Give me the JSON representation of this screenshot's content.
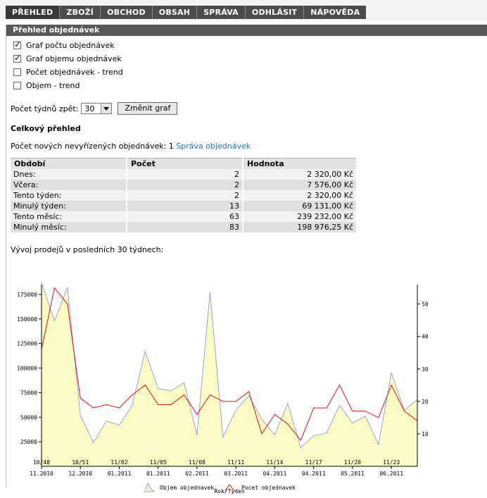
{
  "nav": [
    "PŘEHLED",
    "ZBOŽÍ",
    "OBCHOD",
    "OBSAH",
    "SPRÁVA",
    "ODHLÁSIT",
    "NÁPOVĚDA"
  ],
  "panel_title": "Přehled objednávek",
  "options": [
    {
      "label": "Graf počtu objednávek",
      "checked": true
    },
    {
      "label": "Graf objemu objednávek",
      "checked": true
    },
    {
      "label": "Počet objednávek - trend",
      "checked": false
    },
    {
      "label": "Objem - trend",
      "checked": false
    }
  ],
  "weeks": {
    "label": "Počet týdnů zpět:",
    "value": "30",
    "button": "Změnit graf"
  },
  "overview_title": "Celkový přehled",
  "pending": {
    "text": "Počet nových nevyřízených objednávek: 1",
    "link": "Správa objednávek"
  },
  "table": {
    "headers": [
      "Období",
      "Počet",
      "Hodnota"
    ],
    "rows": [
      [
        "Dnes:",
        "2",
        "2 320,00 Kč"
      ],
      [
        "Včera:",
        "2",
        "7 576,00 Kč"
      ],
      [
        "Tento týden:",
        "2",
        "2 320,00 Kč"
      ],
      [
        "Minulý týden:",
        "13",
        "69 131,00 Kč"
      ],
      [
        "Tento měsíc:",
        "63",
        "239 232,00 Kč"
      ],
      [
        "Minulý měsíc:",
        "83",
        "198 976,25 Kč"
      ]
    ]
  },
  "chart_title": "Vývoj prodejů v posledních 30 týdnech:",
  "chart_data": {
    "type": "line",
    "xlabel": "Rok/Tyden",
    "x_ticks": [
      {
        "week": "10/48",
        "month": "11.2010"
      },
      {
        "week": "10/51",
        "month": "12.2010"
      },
      {
        "week": "11/02",
        "month": "01.2011"
      },
      {
        "week": "11/05",
        "month": "01.2011"
      },
      {
        "week": "11/08",
        "month": "02.2011"
      },
      {
        "week": "11/11",
        "month": "03.2011"
      },
      {
        "week": "11/14",
        "month": "04.2011"
      },
      {
        "week": "11/17",
        "month": "04.2011"
      },
      {
        "week": "11/20",
        "month": "05.2011"
      },
      {
        "week": "11/23",
        "month": "06.2011"
      }
    ],
    "y_left": {
      "ticks": [
        25000,
        50000,
        75000,
        100000,
        125000,
        150000,
        175000
      ],
      "range": [
        0,
        185000
      ]
    },
    "y_right": {
      "ticks": [
        10,
        20,
        30,
        40,
        50
      ],
      "range": [
        0,
        56
      ]
    },
    "series": [
      {
        "name": "Objem objednavek",
        "axis": "left",
        "color": "#9aa0dd",
        "fill": "#fbfbc6",
        "values": [
          187000,
          148000,
          182000,
          52000,
          24000,
          46000,
          42000,
          62000,
          117000,
          79000,
          77000,
          85000,
          32000,
          177000,
          30000,
          57000,
          72000,
          48000,
          32000,
          64000,
          19000,
          31000,
          34000,
          62000,
          44000,
          51000,
          22000,
          95000,
          57000,
          68000
        ]
      },
      {
        "name": "Pocet objednavek",
        "axis": "right",
        "color": "#dd1111",
        "values": [
          36,
          55,
          50,
          21,
          18,
          19,
          18,
          22,
          25,
          19,
          19,
          22,
          16,
          22,
          20,
          20,
          23,
          10,
          16,
          13,
          8,
          18,
          18,
          25,
          17,
          17,
          15,
          25,
          17,
          14
        ]
      }
    ],
    "legend_position": "bottom"
  }
}
